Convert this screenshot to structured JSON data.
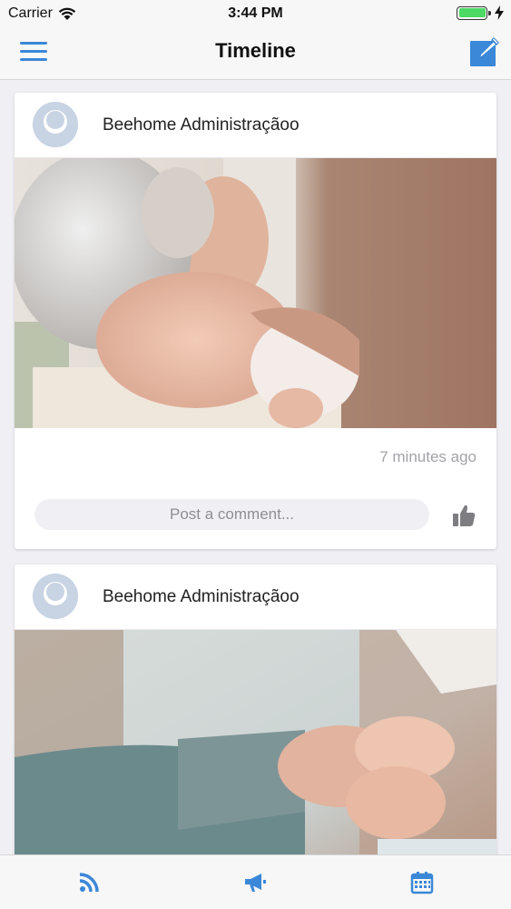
{
  "status_bar": {
    "carrier": "Carrier",
    "time": "3:44 PM"
  },
  "nav": {
    "title": "Timeline"
  },
  "posts": [
    {
      "author": "Beehome Administraçãoo",
      "time": "7 minutes ago",
      "comment_placeholder": "Post a comment..."
    },
    {
      "author": "Beehome Administraçãoo"
    }
  ],
  "colors": {
    "accent": "#3b87d8",
    "battery": "#4cd964"
  },
  "icons": {
    "menu": "hamburger-menu-icon",
    "compose": "compose-icon",
    "like": "thumbs-up-icon",
    "tabs": [
      "rss-feed-icon",
      "megaphone-icon",
      "calendar-icon"
    ]
  }
}
